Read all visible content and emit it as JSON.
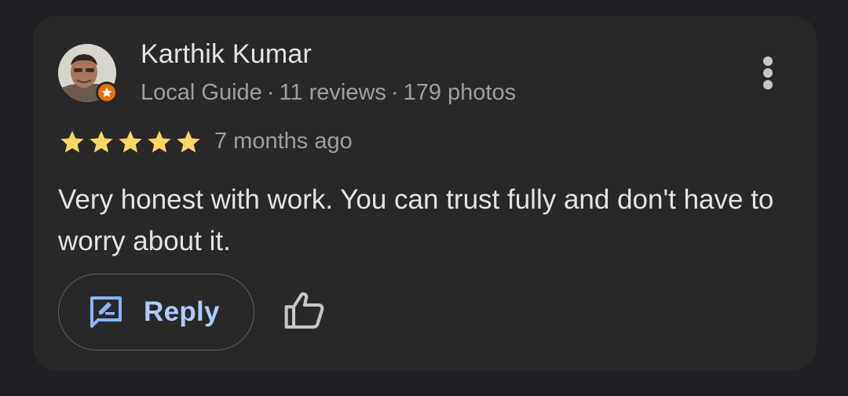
{
  "review": {
    "author": "Karthik Kumar",
    "meta": {
      "badge": "Local Guide",
      "separator": "·",
      "reviews": "11 reviews",
      "photos": "179 photos"
    },
    "rating": 5,
    "rating_max": 5,
    "time": "7 months ago",
    "text": "Very honest with work. You can trust fully and don't have to worry about it.",
    "actions": {
      "reply_label": "Reply"
    }
  },
  "icons": {
    "more": "more-vert-icon",
    "reply": "reply-review-icon",
    "like": "thumb-up-icon",
    "guide": "local-guide-star-icon"
  },
  "colors": {
    "background": "#1f2023",
    "card": "#282828",
    "star": "#fdd663",
    "accent": "#aecbfa",
    "badge": "#e8710a"
  }
}
